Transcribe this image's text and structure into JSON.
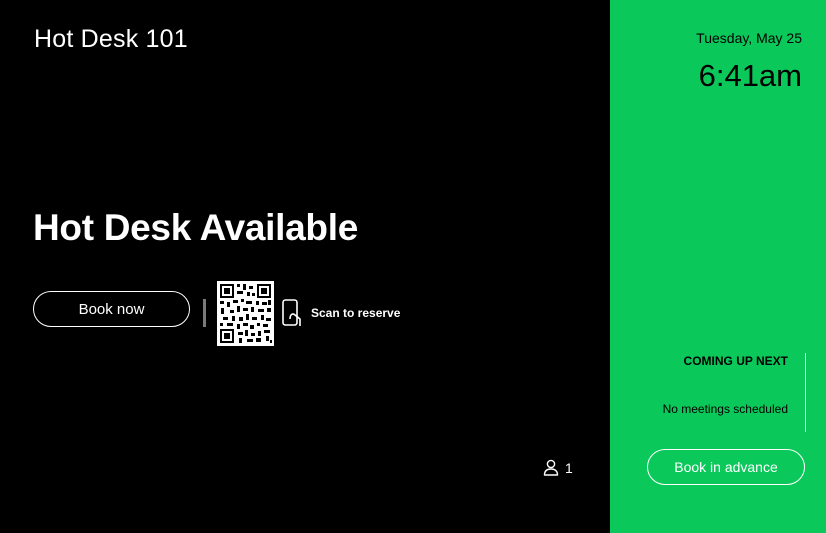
{
  "room": {
    "name": "Hot Desk 101"
  },
  "status": {
    "title": "Hot Desk Available"
  },
  "actions": {
    "book_now_label": "Book now",
    "scan_label": "Scan to reserve",
    "book_advance_label": "Book in advance"
  },
  "occupancy": {
    "count": "1",
    "icon": "person-icon"
  },
  "clock": {
    "date": "Tuesday, May 25",
    "time": "6:41am"
  },
  "agenda": {
    "heading": "COMING UP NEXT",
    "empty_text": "No meetings scheduled"
  },
  "colors": {
    "available_green": "#0ac95a",
    "background": "#000000",
    "text": "#ffffff"
  }
}
